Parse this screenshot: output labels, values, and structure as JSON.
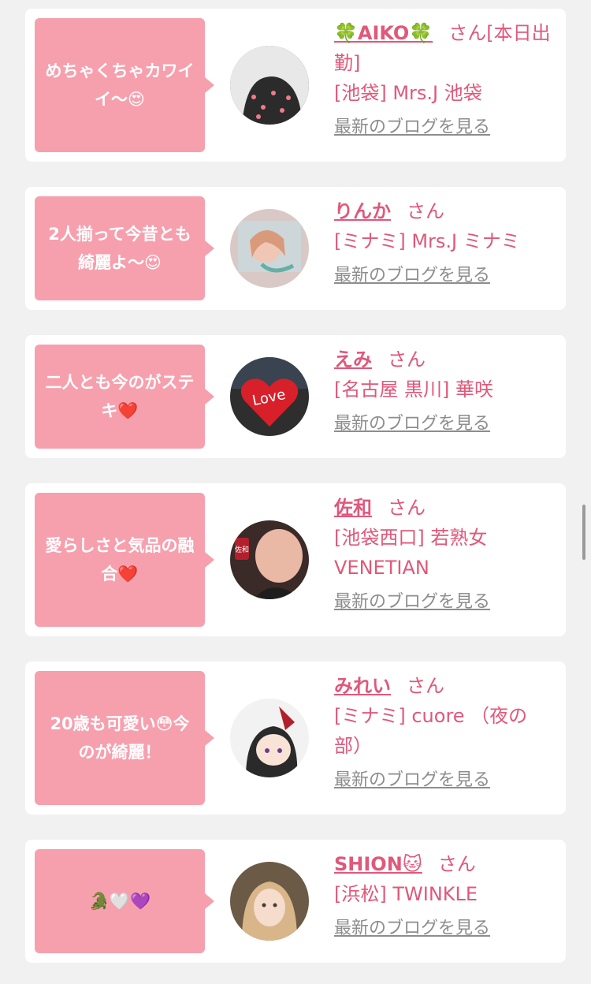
{
  "cards": [
    {
      "comment": "めちゃくちゃカワイイ〜😍",
      "name": "🍀AIKO🍀",
      "suffix": "さん[本日出勤]",
      "shop": "[池袋] Mrs.J 池袋",
      "blog": "最新のブログを見る"
    },
    {
      "comment": "2人揃って今昔とも綺麗よ〜😍",
      "name": "りんか",
      "suffix": "さん",
      "shop": "[ミナミ] Mrs.J ミナミ",
      "blog": "最新のブログを見る"
    },
    {
      "comment": "二人とも今のがステキ❤️",
      "name": "えみ",
      "suffix": "さん",
      "shop": "[名古屋 黒川] 華咲",
      "blog": "最新のブログを見る"
    },
    {
      "comment": "愛らしさと気品の融合❤️",
      "name": "佐和",
      "suffix": "さん",
      "shop": "[池袋西口] 若熟女VENETIAN",
      "blog": "最新のブログを見る"
    },
    {
      "comment": "20歳も可愛い😳今のが綺麗！",
      "name": "みれい",
      "suffix": "さん",
      "shop": "[ミナミ] cuore （夜の部）",
      "blog": "最新のブログを見る"
    },
    {
      "comment": "🐊🤍💜",
      "name": "SHION🐱",
      "suffix": "さん",
      "shop": "[浜松] TWINKLE",
      "blog": "最新のブログを見る"
    }
  ],
  "colors": {
    "accent": "#e0587a",
    "bubble": "#f6a0ae",
    "link_gray": "#8d8d8d",
    "background": "#f1f1f1"
  }
}
